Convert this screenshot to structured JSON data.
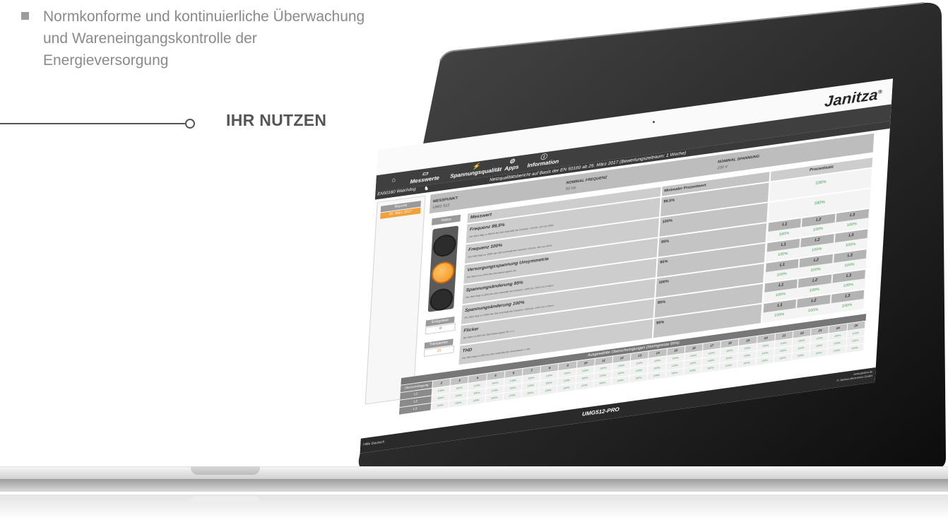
{
  "intro": {
    "bullet_text": "Normkonforme und kontinuierliche Überwachung und Wareneingangskontrolle der Energieversorgung",
    "benefit_heading": "IHR NUTZEN"
  },
  "brand": {
    "name": "Janitza",
    "mark": "®"
  },
  "nav": {
    "items": [
      {
        "label": "",
        "icon": "home-icon"
      },
      {
        "label": "Messwerte",
        "icon": "monitor-icon"
      },
      {
        "label": "Spannungsqualität",
        "icon": "plug-icon"
      },
      {
        "label": "Apps",
        "icon": "apps-icon"
      },
      {
        "label": "Information",
        "icon": "info-icon"
      }
    ]
  },
  "sidebar": {
    "device": "EN50160 Watchdog",
    "head": "Reports",
    "selected": "25. März 2017"
  },
  "report": {
    "title": "Netzqualitätsbericht auf Basis der EN 50160 ab 25. März 2017 (Bewertungszeitraum: 1 Woche)",
    "messpunkt_label": "MESSPUNKT",
    "messpunkt_value": "UMG 512",
    "freq_label": "NOMINAL FREQUENZ",
    "freq_value": "50 Hz",
    "spannung_label": "NOMINAL SPANNUNG",
    "spannung_value": "230 V",
    "col_measure": "Messwert",
    "col_min": "Minimaler Prozentwert",
    "col_result": "Prozentsatz"
  },
  "status": {
    "label": "Status",
    "lamp_on": 2,
    "ereignisse_label": "Ereignisse",
    "ereignisse_value": "0",
    "transienten_label": "Transienten",
    "transienten_value": "25"
  },
  "measurements": [
    {
      "name": "Frequenz 99,5%",
      "desc": "Der Wert liegt zu 99,5% der Zeit innerhalb der Grenzen +1% bis -1% von 50Hz",
      "min": "99.5%",
      "result": "100%"
    },
    {
      "name": "Frequenz 100%",
      "desc": "Der Wert liegt zu 100% der Zeit innerhalb der Grenzen +4% bis -6% von 50Hz",
      "min": "100%",
      "result": "100%"
    },
    {
      "name": "Versorgungsspannung Unsymmetrie",
      "desc": "Der Wert ist zu 95% der Zeit kleiner gleich 2%",
      "min": "95%",
      "phases": [
        "L1",
        "L2",
        "L3"
      ],
      "values": [
        "100%",
        "100%",
        "100%"
      ]
    },
    {
      "name": "Spannungsänderung 95%",
      "desc": "Der Wert liegt zu 95% der Zeit innerhalb der Grenzen +10% bis -10% von U Nenn",
      "min": "95%",
      "phases": [
        "L1",
        "L2",
        "L3"
      ],
      "values": [
        "100%",
        "100%",
        "100%"
      ]
    },
    {
      "name": "Spannungsänderung 100%",
      "desc": "Der Wert liegt zu 100% der Zeit innerhalb der Grenzen +10% bis -15% von U Nenn",
      "min": "100%",
      "phases": [
        "L1",
        "L2",
        "L3"
      ],
      "values": [
        "100%",
        "100%",
        "100%"
      ]
    },
    {
      "name": "Flicker",
      "desc": "Der Wert ist 95% der Zeit kleiner gleich Plt <= 1",
      "min": "95%",
      "phases": [
        "L1",
        "L2",
        "L3"
      ],
      "values": [
        "100%",
        "100%",
        "100%"
      ]
    },
    {
      "name": "THD",
      "desc": "Der Wert liegt zu 95% der Zeit innerhalb der Grenzwerte <= 8%",
      "min": "95%",
      "phases": [
        "L1",
        "L2",
        "L3"
      ],
      "values": [
        "100%",
        "100%",
        "100%"
      ]
    }
  ],
  "harmonics": {
    "title": "Ausgewählte Oberschwingungen (Normgrenze 95%)",
    "header_label": "Oberschwingung",
    "orders": [
      "2",
      "3",
      "4",
      "5",
      "6",
      "7",
      "8",
      "9",
      "10",
      "11",
      "12",
      "13",
      "14",
      "15",
      "16",
      "17",
      "18",
      "19",
      "20",
      "21",
      "22",
      "23",
      "24",
      "25"
    ],
    "rows": [
      {
        "phase": "L1",
        "value": "100%"
      },
      {
        "phase": "L2",
        "value": "100%"
      },
      {
        "phase": "L3",
        "value": "100%"
      }
    ]
  },
  "footer": {
    "left": "Hilfe   Deutsch",
    "center": "UMG512-PRO",
    "right_line1": "www.janitza.de",
    "right_line2": "© Janitza electronics GmbH"
  },
  "colors": {
    "accent": "#f2a03a",
    "ok_green": "#3aa04a",
    "nav_dark": "#3f3f3f"
  }
}
